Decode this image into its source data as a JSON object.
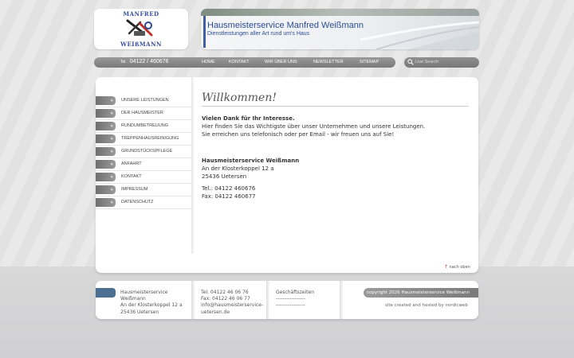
{
  "logo": {
    "line1": "MANFRED",
    "line2": "WEIßMANN"
  },
  "banner": {
    "title": "Hausmeisterservice Manfred Weißmann",
    "subtitle": "Dienstleistungen aller Art rund um's Haus"
  },
  "phone": {
    "prefix": "Tel.",
    "number": "04122 / 460676"
  },
  "nav": [
    "HOME",
    "KONTAKT",
    "WIR ÜBER UNS",
    "NEWSLETTER",
    "SITEMAP"
  ],
  "search": {
    "placeholder": "Live Search"
  },
  "sidebar": [
    "UNSERE LEISTUNGEN",
    "DER HAUSMEISTER",
    "RUNDUMBETREUUNG",
    "TREPPENHAUSREINIGUNG",
    "GRUNDSTÜCKSPFLEGE",
    "ANFAHRT",
    "KONTAKT",
    "IMPRESSUM",
    "DATENSCHUTZ"
  ],
  "content": {
    "heading": "Willkommen!",
    "thanks": "Vielen Dank für Ihr Interesse.",
    "line1": "Hier finden Sie das Wichtigste über unser Unternehmen und unsere Leistungen.",
    "line2": "Sie erreichen uns telefonisch oder per Email - wir freuen uns auf Sie!",
    "company": "Hausmeisterservice Weißmann",
    "street": "An der Klosterkoppel 12 a",
    "city": "25436 Uetersen",
    "tel": "Tel.: 04122 460676",
    "fax": "Fax: 04122 460677"
  },
  "top_link": "nach oben",
  "footer": {
    "address": [
      "Hausmeisterservice",
      "Weißmann",
      "An der Klosterkoppel 12 a",
      "25436 Uetersen"
    ],
    "contact": [
      "Tel: 04122 46 06 76",
      "Fax: 04122 46 06 77",
      "info@hausmeisterservice-",
      "uetersen.de"
    ],
    "hours_title": "Geschäftszeiten",
    "hours": [
      "-----------------",
      "-----------------"
    ],
    "copyright": "copyright 2026 Hausmeisterservice Weißmann",
    "hosted": "site created and hosted by nordicweb"
  },
  "colors": {
    "brand_blue": "#2e4a93",
    "nav_gray": "#888888",
    "footer_blue": "#4d6f93"
  }
}
